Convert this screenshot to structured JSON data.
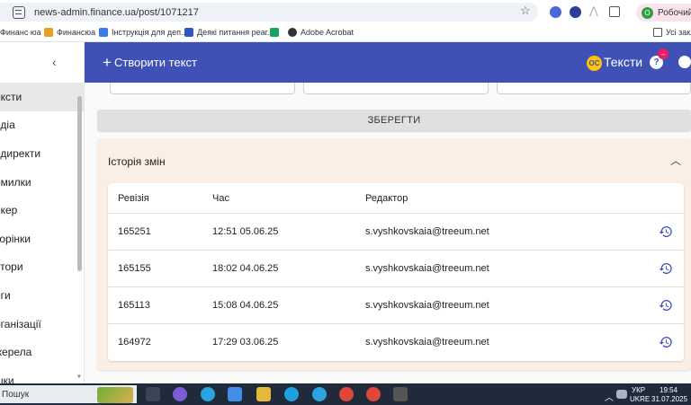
{
  "browser": {
    "url": "news-admin.finance.ua/post/1071217",
    "profile_label": "Робочий",
    "profile_initial": "О"
  },
  "bookmarks": {
    "items": [
      "Финанс юа",
      "Финансюа",
      "Інструкція для деп...",
      "Деякі питання реаг...",
      "",
      "Adobe Acrobat"
    ],
    "all_bookmarks": "Усі закл"
  },
  "sidebar": {
    "items": [
      "ексти",
      "едіа",
      "едиректи",
      "омилки",
      "нкер",
      "торінки",
      "втори",
      "еги",
      "рганізації",
      "жерела",
      "шки"
    ],
    "active_index": 0
  },
  "appbar": {
    "create_label": "Створити текст",
    "section_title": "Тексти",
    "logo_text": "OC",
    "badge_count": "–"
  },
  "main": {
    "save_label": "ЗБЕРЕГТИ",
    "history": {
      "title": "Історія змін",
      "columns": [
        "Ревізія",
        "Час",
        "Редактор"
      ],
      "rows": [
        {
          "revision": "165251",
          "time": "12:51 05.06.25",
          "editor": "s.vyshkovskaia@treeum.net"
        },
        {
          "revision": "165155",
          "time": "18:02 04.06.25",
          "editor": "s.vyshkovskaia@treeum.net"
        },
        {
          "revision": "165113",
          "time": "15:08 04.06.25",
          "editor": "s.vyshkovskaia@treeum.net"
        },
        {
          "revision": "164972",
          "time": "17:29 03.06.25",
          "editor": "s.vyshkovskaia@treeum.net"
        }
      ]
    }
  },
  "taskbar": {
    "search_label": "Пошук",
    "lang_top": "УКР",
    "lang_bottom": "UKRE",
    "time": "19:54",
    "date": "31.07.2025"
  },
  "colors": {
    "appbar": "#3f51b5",
    "history_bg": "#fbeee4",
    "restore_icon": "#3f51b5"
  }
}
